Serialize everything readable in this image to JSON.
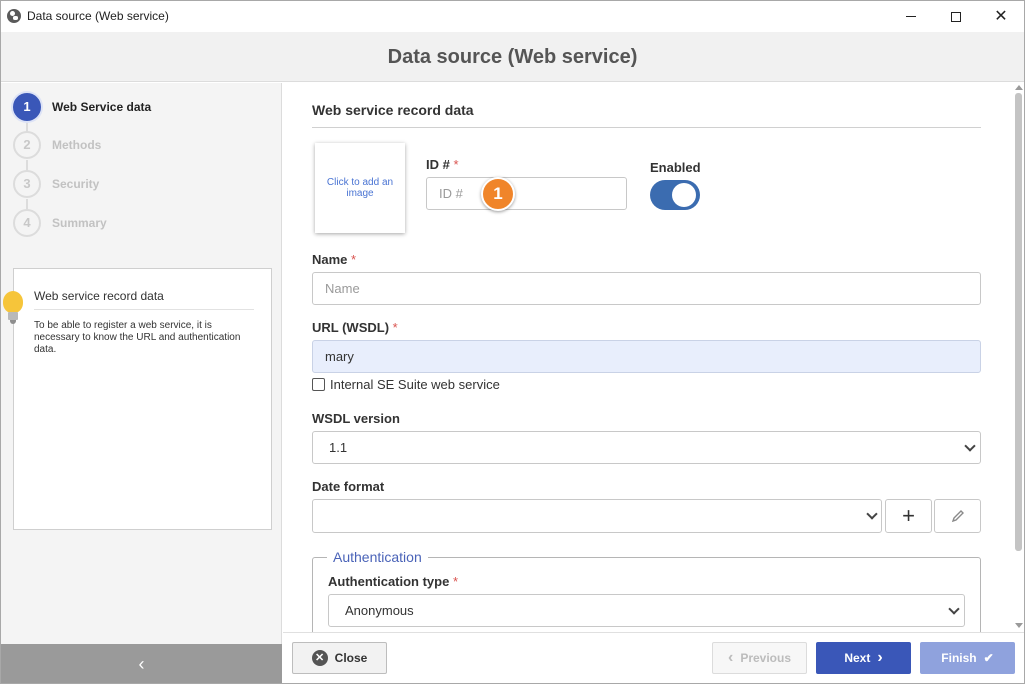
{
  "window": {
    "title": "Data source (Web service)",
    "minimize_icon": "minimize-icon",
    "maximize_icon": "maximize-icon",
    "close_icon": "close-icon"
  },
  "header": {
    "title": "Data source (Web service)"
  },
  "steps": [
    {
      "number": "1",
      "label": "Web Service data",
      "active": true
    },
    {
      "number": "2",
      "label": "Methods",
      "active": false
    },
    {
      "number": "3",
      "label": "Security",
      "active": false
    },
    {
      "number": "4",
      "label": "Summary",
      "active": false
    }
  ],
  "help": {
    "icon": "lightbulb-icon",
    "title": "Web service record data",
    "text": "To be able to register a web service, it is necessary to know the URL and authentication data."
  },
  "sidebar_footer": {
    "icon": "chevron-left-icon",
    "glyph": "‹"
  },
  "form": {
    "section_title": "Web service record data",
    "image_placeholder": "Click to add an image",
    "id": {
      "label": "ID #",
      "required_mark": "*",
      "placeholder": "ID #",
      "value": ""
    },
    "badge": "1",
    "enabled": {
      "label": "Enabled",
      "value": true
    },
    "name": {
      "label": "Name",
      "required_mark": "*",
      "placeholder": "Name",
      "value": ""
    },
    "url": {
      "label": "URL (WSDL)",
      "required_mark": "*",
      "value": "mary"
    },
    "internal_checkbox": {
      "label": "Internal SE Suite web service",
      "checked": false
    },
    "wsdl_version": {
      "label": "WSDL version",
      "value": "1.1"
    },
    "date_format": {
      "label": "Date format",
      "value": "",
      "add_icon": "plus-icon",
      "edit_icon": "pencil-icon"
    },
    "authentication": {
      "legend": "Authentication",
      "type_label": "Authentication type",
      "required_mark": "*",
      "type_value": "Anonymous"
    }
  },
  "buttons": {
    "close": "Close",
    "previous": "Previous",
    "next": "Next",
    "finish": "Finish"
  },
  "colors": {
    "accent": "#3a57b8",
    "badge": "#f0852a",
    "toggle_on": "#3b6cb0",
    "required": "#d9534f"
  }
}
